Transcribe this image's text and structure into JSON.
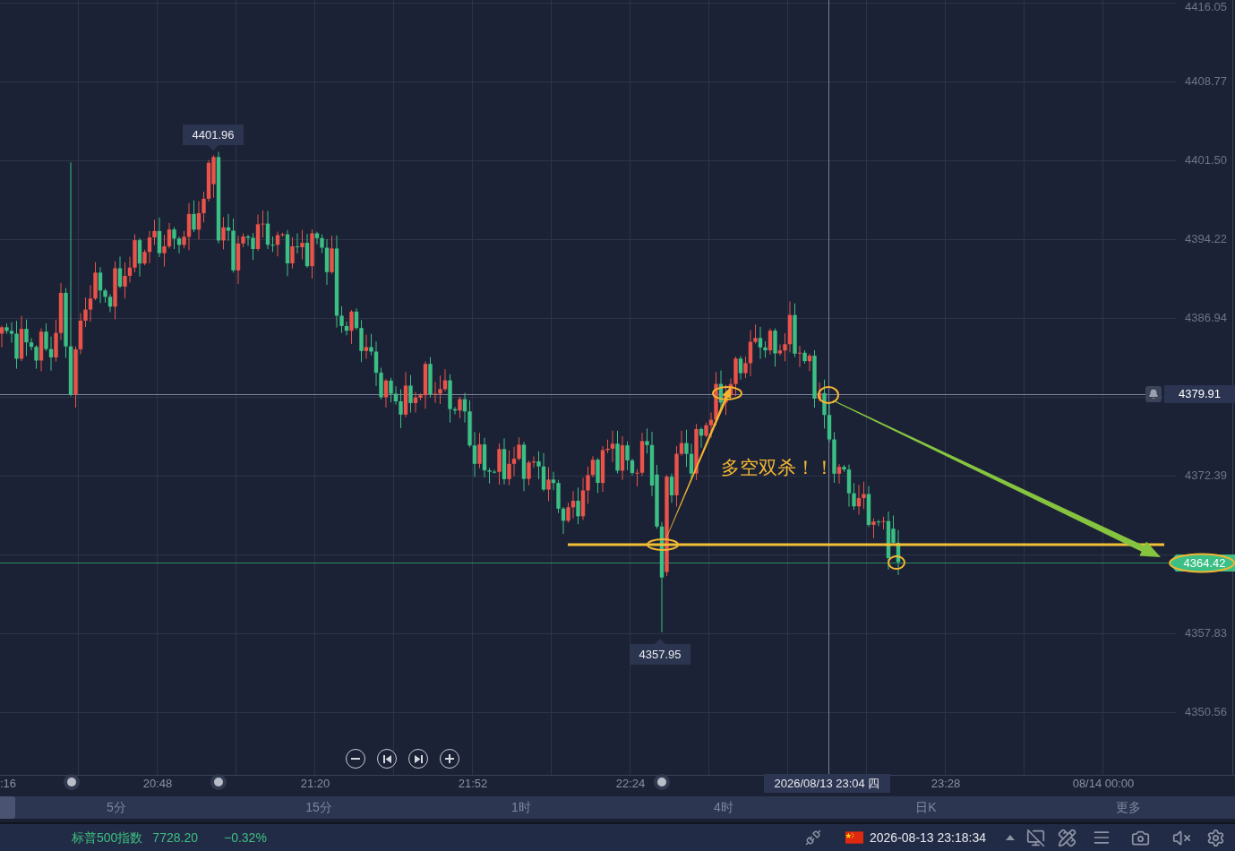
{
  "chart": {
    "price_ticks": [
      "4416.05",
      "4408.77",
      "4401.50",
      "4394.22",
      "4386.94",
      "4372.39",
      "4357.83",
      "4350.56"
    ],
    "time_ticks": [
      ":16",
      "20:48",
      "21:20",
      "21:52",
      "22:24",
      "23:28",
      "08/14 00:00"
    ],
    "high_label": "4401.96",
    "low_label": "4357.95",
    "crosshair": {
      "price": "4379.91",
      "time": "2026/08/13 23:04 四"
    },
    "current_price": "4364.42",
    "annotation": "多空双杀！！"
  },
  "timeframe_tabs": [
    {
      "selected": true
    },
    {
      "label": "5分",
      "selected": false
    },
    {
      "label": "15分",
      "selected": false
    },
    {
      "label": "1时",
      "selected": false
    },
    {
      "label": "4时",
      "selected": false
    },
    {
      "label": "日K",
      "selected": false
    },
    {
      "label": "更多",
      "selected": false
    }
  ],
  "status_bar": {
    "index_name": "标普500指数",
    "price": "7728.20",
    "change": "−0.32%",
    "falling": true,
    "clock": "2026-08-13 23:18:34"
  }
}
